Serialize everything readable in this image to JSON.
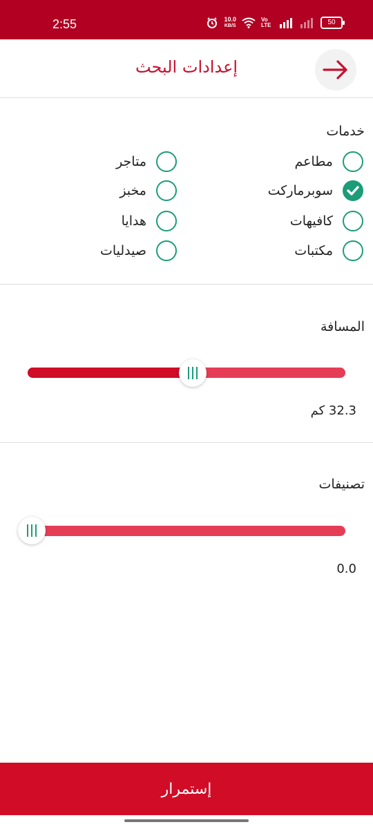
{
  "status_bar": {
    "time": "2:55",
    "net_speed": "10.0",
    "net_speed_unit": "KB/S",
    "volte": "Vo LTE",
    "battery": "50"
  },
  "header": {
    "title": "إعدادات البحث",
    "back_icon": "arrow-right-icon"
  },
  "services": {
    "title": "خدمات",
    "items": [
      {
        "label": "مطاعم",
        "checked": false
      },
      {
        "label": "متاجر",
        "checked": false
      },
      {
        "label": "سوبرماركت",
        "checked": true
      },
      {
        "label": "مخبز",
        "checked": false
      },
      {
        "label": "كافيهات",
        "checked": false
      },
      {
        "label": "هدايا",
        "checked": false
      },
      {
        "label": "مكتبات",
        "checked": false
      },
      {
        "label": "صيدليات",
        "checked": false
      }
    ]
  },
  "distance": {
    "title": "المسافة",
    "value_text": "32.3 كم",
    "value_fraction": 0.52
  },
  "ratings": {
    "title": "تصنيفات",
    "value_text": "0.0",
    "value_fraction": 0.0
  },
  "continue_button": "إستمرار",
  "colors": {
    "brand_red": "#c8102e",
    "status_bar": "#b10022",
    "check_green": "#1c9c78"
  }
}
